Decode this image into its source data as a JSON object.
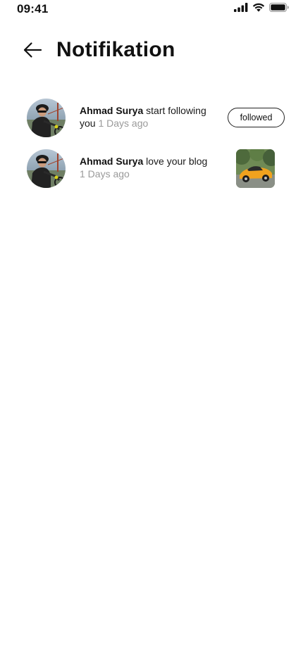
{
  "status_bar": {
    "time": "09:41",
    "icons": [
      "cellular-signal-icon",
      "wifi-icon",
      "battery-icon"
    ]
  },
  "header": {
    "back_icon": "arrow-left-icon",
    "title": "Notifikation"
  },
  "notifications": [
    {
      "user": "Ahmad Surya",
      "message": "start following you",
      "time": "1 Days ago",
      "action_label": "followed",
      "avatar_icon": "cyclist-avatar"
    },
    {
      "user": "Ahmad Surya",
      "message": "love your blog",
      "time": "1 Days ago",
      "thumbnail_icon": "orange-sports-car-thumbnail",
      "avatar_icon": "cyclist-avatar"
    }
  ],
  "colors": {
    "text_primary": "#111111",
    "text_muted": "#9a9a9a",
    "background": "#ffffff"
  }
}
